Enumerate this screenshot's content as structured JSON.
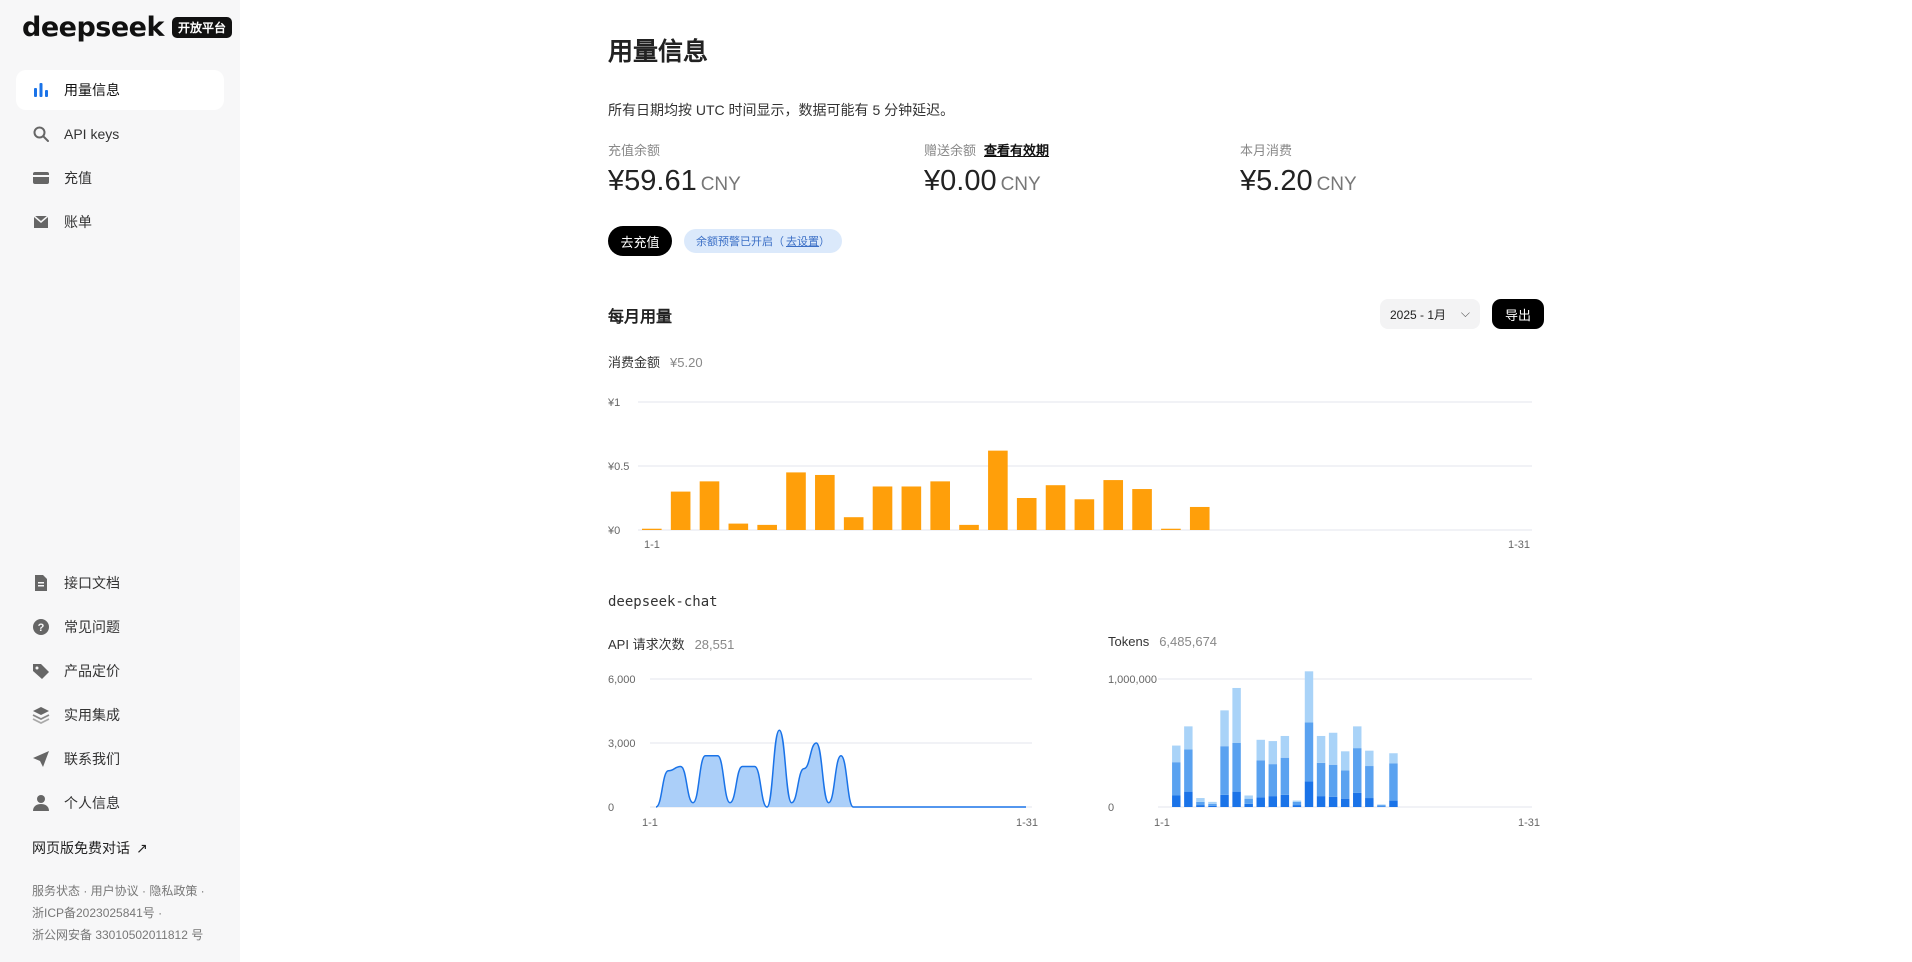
{
  "sidebar": {
    "logo": "deepseek",
    "badge": "开放平台",
    "top_items": [
      {
        "label": "用量信息",
        "icon": "bar-chart-icon",
        "active": true
      },
      {
        "label": "API keys",
        "icon": "search-icon"
      },
      {
        "label": "充值",
        "icon": "card-icon"
      },
      {
        "label": "账单",
        "icon": "inbox-icon"
      }
    ],
    "bottom_items": [
      {
        "label": "接口文档",
        "icon": "document-icon"
      },
      {
        "label": "常见问题",
        "icon": "help-icon"
      },
      {
        "label": "产品定价",
        "icon": "tag-icon"
      },
      {
        "label": "实用集成",
        "icon": "layers-icon"
      },
      {
        "label": "联系我们",
        "icon": "send-icon"
      },
      {
        "label": "个人信息",
        "icon": "user-icon"
      }
    ],
    "web_chat": "网页版免费对话",
    "footer_line1": "服务状态 · 用户协议 · 隐私政策 ·",
    "footer_line2": "浙ICP备2023025841号 ·",
    "footer_line3": "浙公网安备 33010502011812 号"
  },
  "main": {
    "title": "用量信息",
    "notice": "所有日期均按 UTC 时间显示，数据可能有 5 分钟延迟。",
    "balances": [
      {
        "label": "充值余额",
        "amount": "¥59.61",
        "unit": "CNY"
      },
      {
        "label": "赠送余额",
        "link": "查看有效期",
        "amount": "¥0.00",
        "unit": "CNY"
      },
      {
        "label": "本月消费",
        "amount": "¥5.20",
        "unit": "CNY"
      }
    ],
    "recharge_button": "去充值",
    "alert_text": "余额预警已开启（",
    "alert_link": "去设置",
    "alert_close": "）",
    "monthly_title": "每月用量",
    "month_value": "2025 - 1月",
    "export_button": "导出",
    "spend_label": "消费金额",
    "spend_value": "¥5.20",
    "model_name": "deepseek-chat",
    "requests_label": "API 请求次数",
    "requests_value": "28,551",
    "tokens_label": "Tokens",
    "tokens_value": "6,485,674"
  },
  "chart_data": [
    {
      "type": "bar",
      "ylabel_ticks": [
        "¥0",
        "¥0.5",
        "¥1"
      ],
      "ylim": [
        0,
        1
      ],
      "x_range_labels": [
        "1-1",
        "1-31"
      ],
      "categories": [
        "1",
        "2",
        "3",
        "4",
        "5",
        "6",
        "7",
        "8",
        "9",
        "10",
        "11",
        "12",
        "13",
        "14",
        "15",
        "16",
        "17",
        "18",
        "19",
        "20",
        "21",
        "22",
        "23",
        "24",
        "25",
        "26",
        "27",
        "28",
        "29",
        "30",
        "31"
      ],
      "values": [
        0.01,
        0.3,
        0.38,
        0.05,
        0.04,
        0.45,
        0.43,
        0.1,
        0.34,
        0.34,
        0.38,
        0.04,
        0.62,
        0.25,
        0.35,
        0.24,
        0.39,
        0.32,
        0.01,
        0.18,
        0,
        0,
        0,
        0,
        0,
        0,
        0,
        0,
        0,
        0,
        0
      ],
      "color": "#ff9f0a"
    },
    {
      "type": "area",
      "ylabel_ticks": [
        "0",
        "3,000",
        "6,000"
      ],
      "ylim": [
        0,
        6000
      ],
      "x_range_labels": [
        "1-1",
        "1-31"
      ],
      "x": [
        1,
        2,
        3,
        4,
        5,
        6,
        7,
        8,
        9,
        10,
        11,
        12,
        13,
        14,
        15,
        16,
        17,
        18,
        19,
        20,
        21,
        22,
        23,
        24,
        25,
        26,
        27,
        28,
        29,
        30,
        31
      ],
      "values": [
        0,
        1700,
        1900,
        200,
        2400,
        2400,
        200,
        1900,
        1900,
        0,
        3600,
        200,
        1800,
        3000,
        200,
        2400,
        0,
        0,
        0,
        0,
        0,
        0,
        0,
        0,
        0,
        0,
        0,
        0,
        0,
        0,
        0
      ],
      "color": "#9cc7f8"
    },
    {
      "type": "bar",
      "stacked": true,
      "ylabel_ticks": [
        "0",
        "1,000,000"
      ],
      "ylim": [
        0,
        1000000
      ],
      "x_range_labels": [
        "1-1",
        "1-31"
      ],
      "categories": [
        "1",
        "2",
        "3",
        "4",
        "5",
        "6",
        "7",
        "8",
        "9",
        "10",
        "11",
        "12",
        "13",
        "14",
        "15",
        "16",
        "17",
        "18",
        "19",
        "20",
        "21",
        "22",
        "23",
        "24",
        "25",
        "26",
        "27",
        "28",
        "29",
        "30",
        "31"
      ],
      "series": [
        {
          "values": [
            0,
            90000,
            120000,
            15000,
            10000,
            95000,
            120000,
            25000,
            75000,
            85000,
            95000,
            15000,
            200000,
            85000,
            80000,
            65000,
            110000,
            70000,
            5000,
            50000,
            0,
            0,
            0,
            0,
            0,
            0,
            0,
            0,
            0,
            0,
            0
          ],
          "color": "#1a73e8"
        },
        {
          "values": [
            0,
            260000,
            330000,
            25000,
            15000,
            380000,
            380000,
            40000,
            290000,
            250000,
            290000,
            25000,
            460000,
            260000,
            250000,
            220000,
            350000,
            250000,
            10000,
            290000,
            0,
            0,
            0,
            0,
            0,
            0,
            0,
            0,
            0,
            0,
            0
          ],
          "color": "#5aa2f0"
        },
        {
          "values": [
            0,
            130000,
            180000,
            30000,
            15000,
            280000,
            430000,
            25000,
            160000,
            180000,
            170000,
            10000,
            400000,
            210000,
            250000,
            150000,
            170000,
            120000,
            5000,
            80000,
            0,
            0,
            0,
            0,
            0,
            0,
            0,
            0,
            0,
            0,
            0
          ],
          "color": "#a9d3f8"
        }
      ]
    }
  ]
}
